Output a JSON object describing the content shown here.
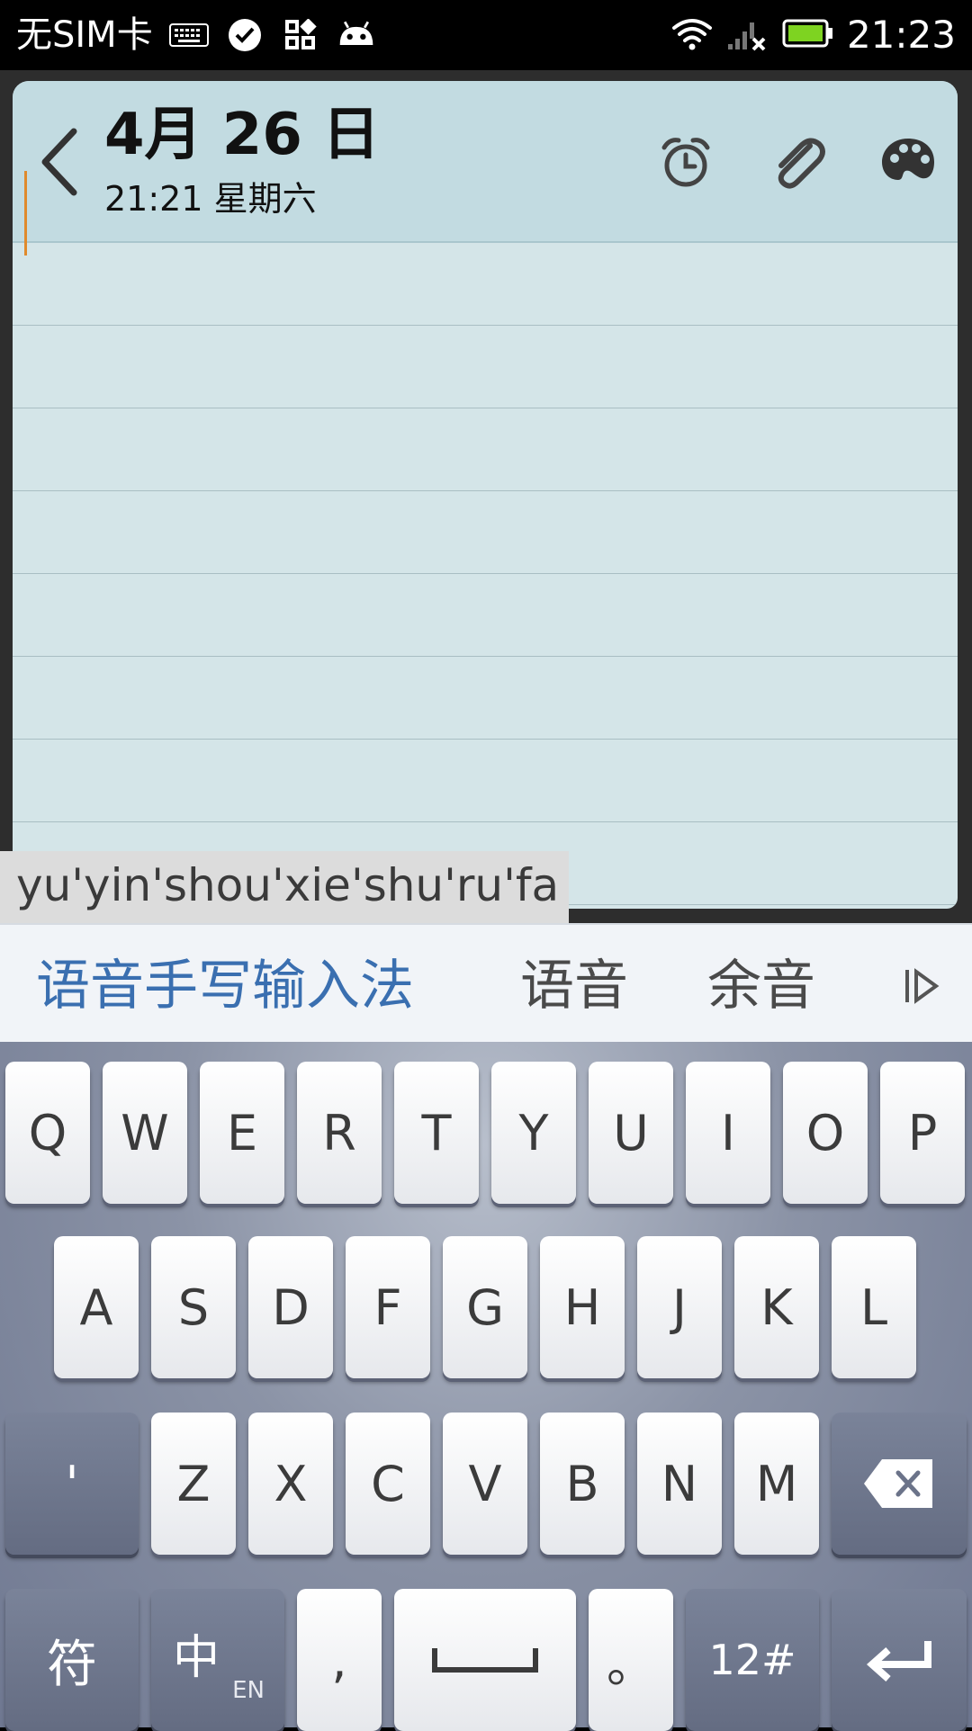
{
  "status_bar": {
    "carrier": "无SIM卡",
    "time": "21:23",
    "icons": [
      "keyboard-icon",
      "check-circle-icon",
      "apps-icon",
      "android-icon",
      "wifi-icon",
      "signal-icon",
      "battery-icon"
    ]
  },
  "note": {
    "date_title": "4月 26 日",
    "date_subtitle": "21:21 星期六",
    "icons": [
      "back-chevron-icon",
      "alarm-icon",
      "attachment-icon",
      "palette-icon"
    ]
  },
  "ime": {
    "composing": "yu'yin'shou'xie'shu'ru'fa",
    "candidates": [
      "语音手写输入法",
      "语音",
      "余音"
    ],
    "row1": [
      "Q",
      "W",
      "E",
      "R",
      "T",
      "Y",
      "U",
      "I",
      "O",
      "P"
    ],
    "row2": [
      "A",
      "S",
      "D",
      "F",
      "G",
      "H",
      "J",
      "K",
      "L"
    ],
    "row3_left": "'",
    "row3": [
      "Z",
      "X",
      "C",
      "V",
      "B",
      "N",
      "M"
    ],
    "symbols_key": "符",
    "lang_key": "中",
    "lang_key_sub": "EN",
    "comma_key": ",",
    "period_key": "。",
    "numbers_key": "12#",
    "colors": {
      "candidate_active": "#3a6fb0",
      "note_bg": "#d4e5e8",
      "caret": "#e08a2c"
    }
  }
}
